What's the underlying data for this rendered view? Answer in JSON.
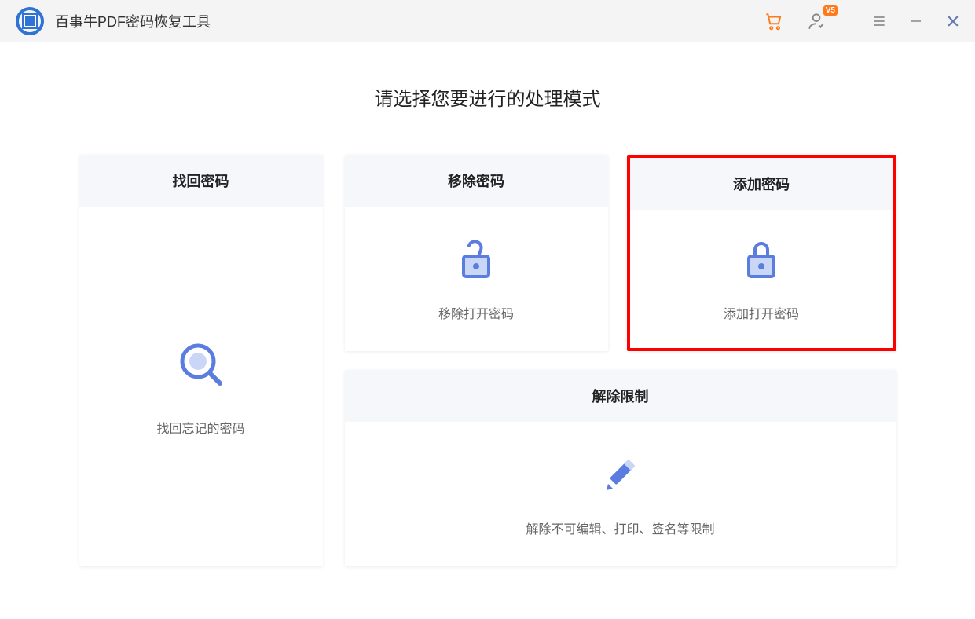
{
  "app": {
    "title": "百事牛PDF密码恢复工具"
  },
  "userBadge": "V5",
  "heading": "请选择您要进行的处理模式",
  "cards": {
    "recover": {
      "title": "找回密码",
      "desc": "找回忘记的密码"
    },
    "remove": {
      "title": "移除密码",
      "desc": "移除打开密码"
    },
    "add": {
      "title": "添加密码",
      "desc": "添加打开密码"
    },
    "unrestrict": {
      "title": "解除限制",
      "desc": "解除不可编辑、打印、签名等限制"
    }
  }
}
